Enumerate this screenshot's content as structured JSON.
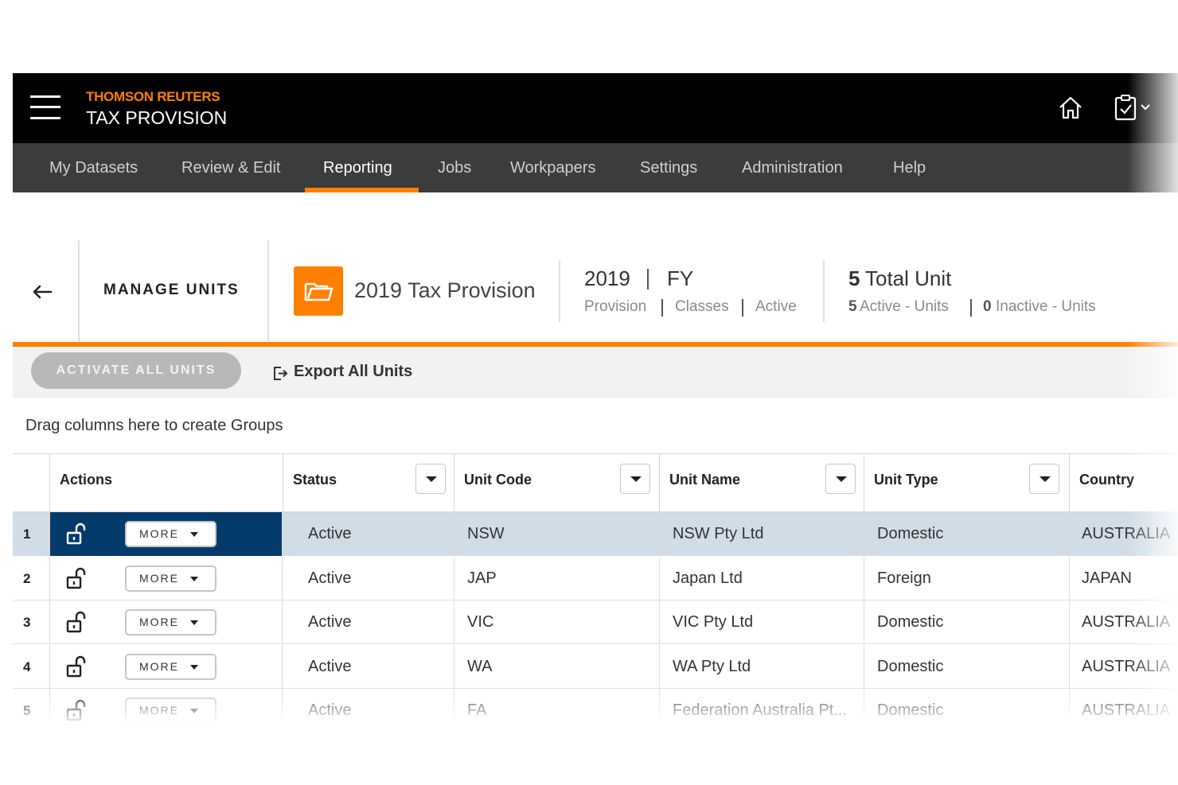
{
  "app": {
    "brand_top": "THOMSON REUTERS",
    "brand_bottom": "TAX PROVISION",
    "accent_color": "#ff8000",
    "icons": [
      "hamburger-menu-icon",
      "home-icon",
      "task-checklist-icon"
    ]
  },
  "nav": {
    "items": [
      {
        "label": "My Datasets"
      },
      {
        "label": "Review & Edit"
      },
      {
        "label": "Reporting",
        "active": true
      },
      {
        "label": "Jobs"
      },
      {
        "label": "Workpapers"
      },
      {
        "label": "Settings"
      },
      {
        "label": "Administration"
      },
      {
        "label": "Help"
      }
    ]
  },
  "header": {
    "title": "MANAGE UNITS",
    "dataset_name": "2019 Tax Provision",
    "year": "2019",
    "period": "FY",
    "sub_labels": [
      "Provision",
      "Classes",
      "Active"
    ],
    "total_units": "5",
    "total_label": "Total Unit",
    "active_count": "5",
    "active_label": "Active - Units",
    "inactive_count": "0",
    "inactive_label": "Inactive - Units"
  },
  "toolbar": {
    "activate_all": "ACTIVATE ALL UNITS",
    "export_all": "Export All Units"
  },
  "group_hint": "Drag columns here to create Groups",
  "grid": {
    "columns": [
      "Actions",
      "Status",
      "Unit Code",
      "Unit Name",
      "Unit Type",
      "Country"
    ],
    "more_label": "MORE",
    "rows": [
      {
        "num": "1",
        "status": "Active",
        "code": "NSW",
        "name": "NSW Pty Ltd",
        "type": "Domestic",
        "country": "AUSTRALIA",
        "selected": true
      },
      {
        "num": "2",
        "status": "Active",
        "code": "JAP",
        "name": "Japan Ltd",
        "type": "Foreign",
        "country": "JAPAN"
      },
      {
        "num": "3",
        "status": "Active",
        "code": "VIC",
        "name": "VIC Pty Ltd",
        "type": "Domestic",
        "country": "AUSTRALIA"
      },
      {
        "num": "4",
        "status": "Active",
        "code": "WA",
        "name": "WA Pty Ltd",
        "type": "Domestic",
        "country": "AUSTRALIA"
      },
      {
        "num": "5",
        "status": "Active",
        "code": "FA",
        "name": "Federation Australia Pt...",
        "type": "Domestic",
        "country": "AUSTRALIA"
      }
    ]
  }
}
